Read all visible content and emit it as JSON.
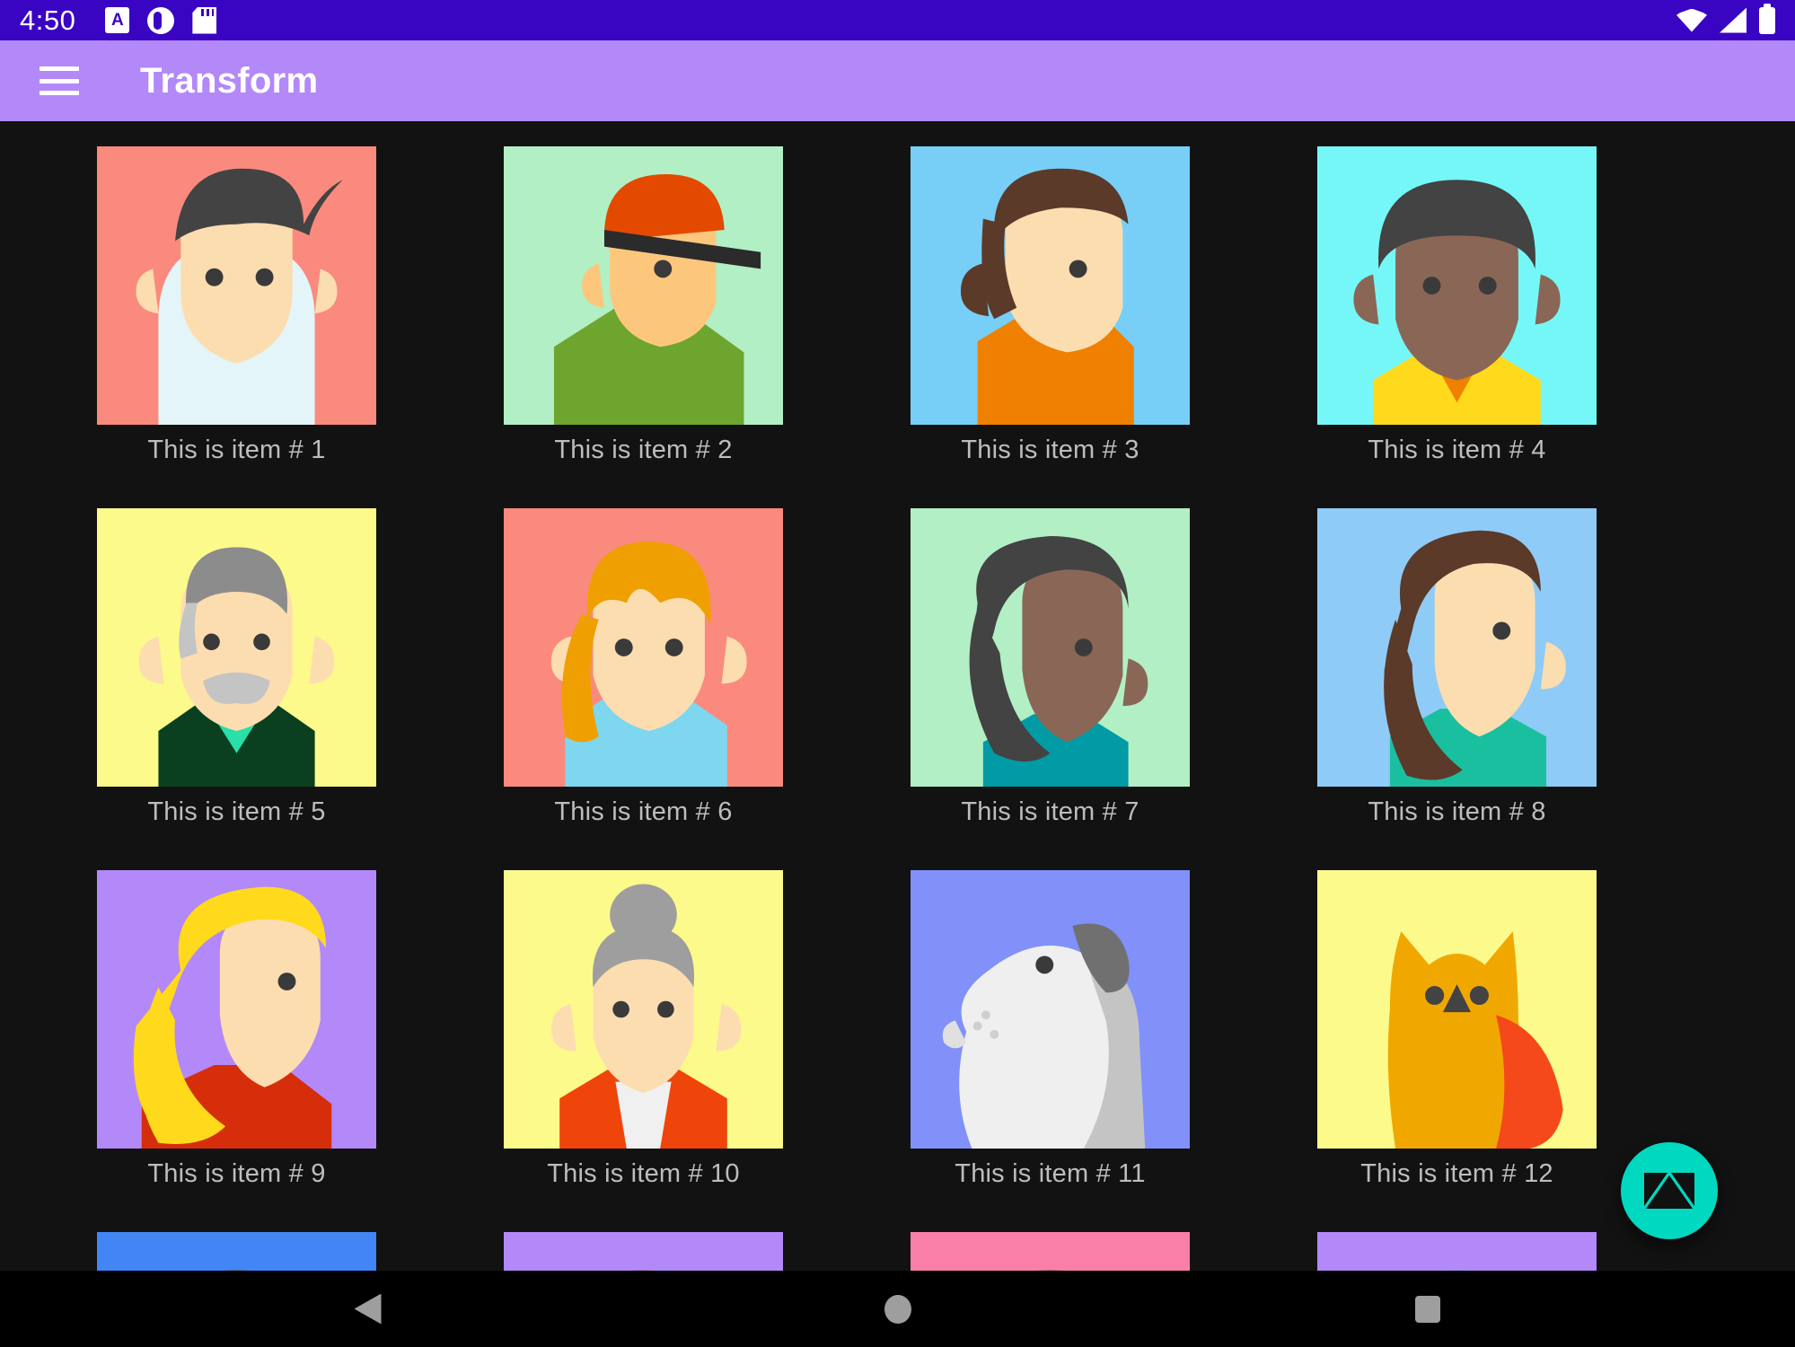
{
  "status_bar": {
    "time": "4:50",
    "left_icons": [
      "app-badge-icon",
      "do-not-disturb-icon",
      "sd-card-icon"
    ],
    "right_icons": [
      "wifi-icon",
      "cellular-signal-icon",
      "battery-icon"
    ],
    "background": "#3A04C3"
  },
  "app_bar": {
    "menu_icon": "hamburger-menu-icon",
    "title": "Transform",
    "background": "#B388F9",
    "text_color": "#FFFFFF"
  },
  "grid": {
    "columns": 4,
    "caption_color": "#BDBDBD",
    "background": "#121212",
    "items": [
      {
        "caption": "This is item # 1",
        "bg": "#FA8A7E",
        "kind": "person-dark-hair-spike",
        "skin": "#FCDDB0",
        "hair": "#434343",
        "shirt": "#E3F5F8"
      },
      {
        "caption": "This is item # 2",
        "bg": "#B2EFC4",
        "kind": "person-orange-cap",
        "skin": "#FCC77D",
        "hair": "#E34A00",
        "shirt": "#6DA52F"
      },
      {
        "caption": "This is item # 3",
        "bg": "#77CFF7",
        "kind": "person-brown-bob",
        "skin": "#FCDDB0",
        "hair": "#5B3A29",
        "shirt": "#F08000"
      },
      {
        "caption": "This is item # 4",
        "bg": "#76F7F7",
        "kind": "person-afro",
        "skin": "#8A6656",
        "hair": "#434343",
        "shirt": "#FFD91C"
      },
      {
        "caption": "This is item # 5",
        "bg": "#FCFA8B",
        "kind": "person-grey-moustache",
        "skin": "#FCDDB0",
        "hair": "#8C8C8C",
        "shirt": "#0A4020"
      },
      {
        "caption": "This is item # 6",
        "bg": "#FA8A7E",
        "kind": "person-blonde-ponytail",
        "skin": "#FCDDB0",
        "hair": "#EFA000",
        "shirt": "#7ED7EF"
      },
      {
        "caption": "This is item # 7",
        "bg": "#B2EFC4",
        "kind": "person-dark-bouffant",
        "skin": "#8A6656",
        "hair": "#434343",
        "shirt": "#009BA5"
      },
      {
        "caption": "This is item # 8",
        "bg": "#8FCBF7",
        "kind": "person-long-brown-hair",
        "skin": "#FCDDB0",
        "hair": "#5B3A29",
        "shirt": "#1ABFA0"
      },
      {
        "caption": "This is item # 9",
        "bg": "#B388F9",
        "kind": "person-blonde-long",
        "skin": "#FCDDB0",
        "hair": "#FFD91C",
        "shirt": "#D62D0A"
      },
      {
        "caption": "This is item # 10",
        "bg": "#FCFA8B",
        "kind": "person-grey-bun",
        "skin": "#FCDDB0",
        "hair": "#9E9E9E",
        "shirt": "#F0450A"
      },
      {
        "caption": "This is item # 11",
        "bg": "#8191F9",
        "kind": "dog",
        "skin": "#EFEFEF",
        "hair": "#707070",
        "shirt": "#C4C4C4"
      },
      {
        "caption": "This is item # 12",
        "bg": "#FCFA8B",
        "kind": "owl",
        "skin": "#F0A800",
        "hair": "#434343",
        "shirt": "#F5491B"
      },
      {
        "caption": "",
        "bg": "#4285F4",
        "kind": "partial-head",
        "skin": "#5B3A29",
        "hair": "#5B3A29",
        "shirt": "#4285F4"
      },
      {
        "caption": "",
        "bg": "#B388F9",
        "kind": "partial-head",
        "skin": "#8A6656",
        "hair": "#7A5234",
        "shirt": "#B388F9"
      },
      {
        "caption": "",
        "bg": "#FA7FA8",
        "kind": "partial-head",
        "skin": "#5B3A29",
        "hair": "#4A3426",
        "shirt": "#FA7FA8"
      },
      {
        "caption": "",
        "bg": "#B388F9",
        "kind": "partial-head",
        "skin": "#8C8C8C",
        "hair": "#8C8C8C",
        "shirt": "#B388F9"
      }
    ]
  },
  "fab": {
    "icon": "email-envelope-icon",
    "background": "#00D9C0",
    "label": "Compose email"
  },
  "nav_bar": {
    "back": "back-triangle-icon",
    "home": "home-circle-icon",
    "recents": "recents-square-icon"
  }
}
